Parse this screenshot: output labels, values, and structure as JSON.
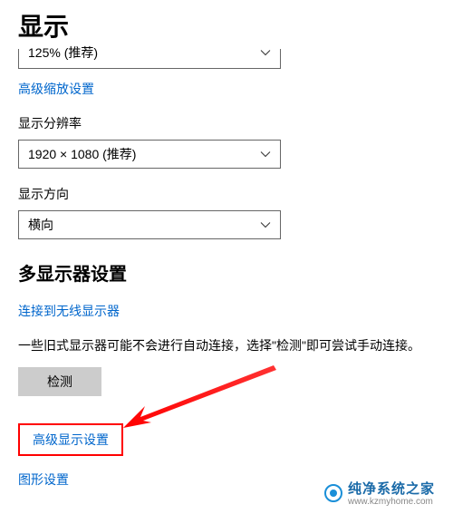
{
  "page": {
    "title": "显示"
  },
  "scale": {
    "value": "125% (推荐)",
    "advanced_link": "高级缩放设置"
  },
  "resolution": {
    "label": "显示分辨率",
    "value": "1920 × 1080 (推荐)"
  },
  "orientation": {
    "label": "显示方向",
    "value": "横向"
  },
  "multi_display": {
    "section_title": "多显示器设置",
    "wireless_link": "连接到无线显示器",
    "legacy_text": "一些旧式显示器可能不会进行自动连接，选择\"检测\"即可尝试手动连接。",
    "detect_button": "检测",
    "advanced_link": "高级显示设置",
    "graphics_link": "图形设置"
  },
  "watermark": {
    "brand": "纯净系统之家",
    "url": "www.kzmyhome.com"
  }
}
